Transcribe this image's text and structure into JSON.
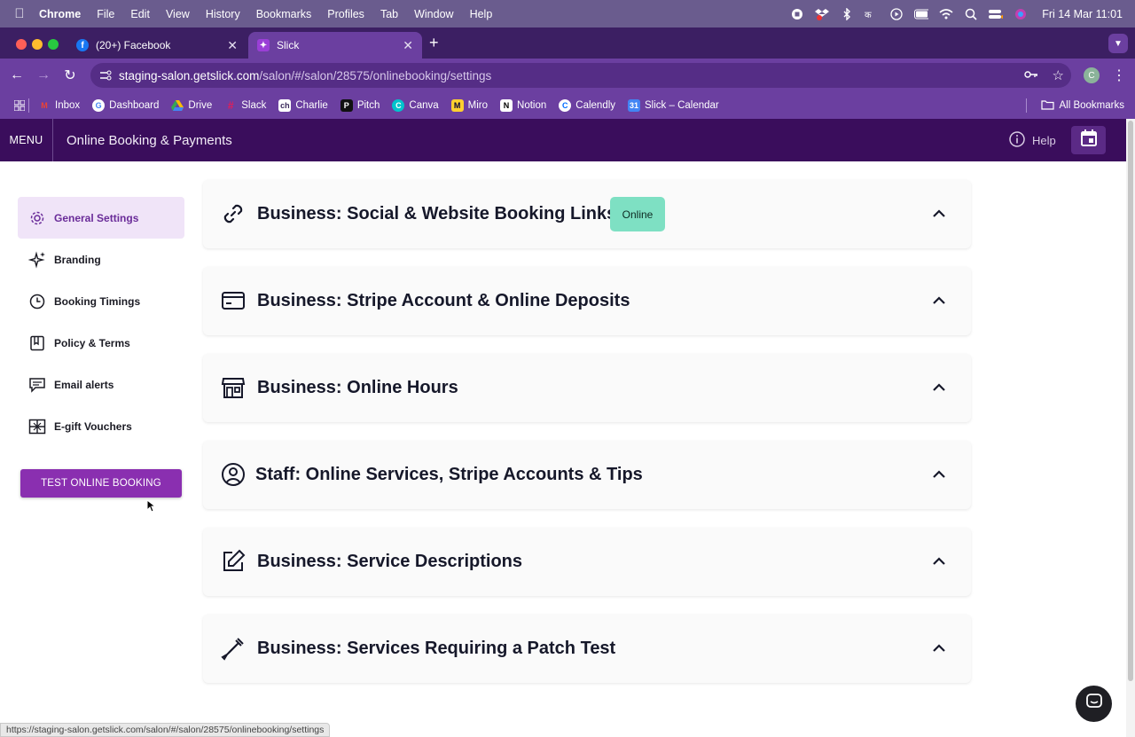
{
  "macos_menu": {
    "app_name": "Chrome",
    "items": [
      "File",
      "Edit",
      "View",
      "History",
      "Bookmarks",
      "Profiles",
      "Tab",
      "Window",
      "Help"
    ],
    "datetime": "Fri 14 Mar  11:01"
  },
  "tabs": [
    {
      "title": "(20+) Facebook",
      "icon": "facebook-icon",
      "active": false
    },
    {
      "title": "Slick",
      "icon": "slick-icon",
      "active": true
    }
  ],
  "address_bar": {
    "url_host": "staging-salon.getslick.com",
    "url_path": "/salon/#/salon/28575/onlinebooking/settings",
    "profile_initial": "C"
  },
  "bookmarks": {
    "items": [
      {
        "label": "Inbox",
        "icon": "gmail-icon",
        "color": "#ea4335"
      },
      {
        "label": "Dashboard",
        "icon": "google-icon",
        "color": "#4285f4"
      },
      {
        "label": "Drive",
        "icon": "drive-icon",
        "color": "#34a853"
      },
      {
        "label": "Slack",
        "icon": "slack-icon",
        "color": "#e01e5a"
      },
      {
        "label": "Charlie",
        "icon": "charlie-icon",
        "color": "#ffffff"
      },
      {
        "label": "Pitch",
        "icon": "pitch-icon",
        "color": "#111111"
      },
      {
        "label": "Canva",
        "icon": "canva-icon",
        "color": "#00c4cc"
      },
      {
        "label": "Miro",
        "icon": "miro-icon",
        "color": "#ffd02f"
      },
      {
        "label": "Notion",
        "icon": "notion-icon",
        "color": "#ffffff"
      },
      {
        "label": "Calendly",
        "icon": "calendly-icon",
        "color": "#006bff"
      },
      {
        "label": "Slick – Calendar",
        "icon": "calendar-icon",
        "color": "#4285f4"
      }
    ],
    "all_bookmarks": "All Bookmarks"
  },
  "app_header": {
    "menu_label": "MENU",
    "title": "Online Booking & Payments",
    "help_label": "Help"
  },
  "sidebar": {
    "items": [
      {
        "label": "General Settings",
        "icon": "gear-icon",
        "active": true
      },
      {
        "label": "Branding",
        "icon": "sparkles-icon",
        "active": false
      },
      {
        "label": "Booking Timings",
        "icon": "clock-icon",
        "active": false
      },
      {
        "label": "Policy & Terms",
        "icon": "book-icon",
        "active": false
      },
      {
        "label": "Email alerts",
        "icon": "chat-icon",
        "active": false
      },
      {
        "label": "E-gift Vouchers",
        "icon": "gift-icon",
        "active": false
      }
    ],
    "test_button": "TEST ONLINE BOOKING"
  },
  "sections": [
    {
      "title": "Business: Social & Website Booking Links",
      "icon": "link-icon",
      "badge": "Online"
    },
    {
      "title": "Business: Stripe Account & Online Deposits",
      "icon": "credit-card-icon"
    },
    {
      "title": "Business: Online Hours",
      "icon": "storefront-icon"
    },
    {
      "title": "Staff: Online Services, Stripe Accounts & Tips",
      "icon": "user-circle-icon"
    },
    {
      "title": "Business: Service Descriptions",
      "icon": "edit-icon"
    },
    {
      "title": "Business: Services Requiring a Patch Test",
      "icon": "pipette-icon"
    }
  ],
  "status_url": "https://staging-salon.getslick.com/salon/#/salon/28575/onlinebooking/settings",
  "colors": {
    "header_bg": "#3a0d5c",
    "browser_purple": "#6b3fa0",
    "accent": "#8a2fb0",
    "badge_green": "#7ee0c3",
    "active_side_bg": "#f0e4f8"
  }
}
